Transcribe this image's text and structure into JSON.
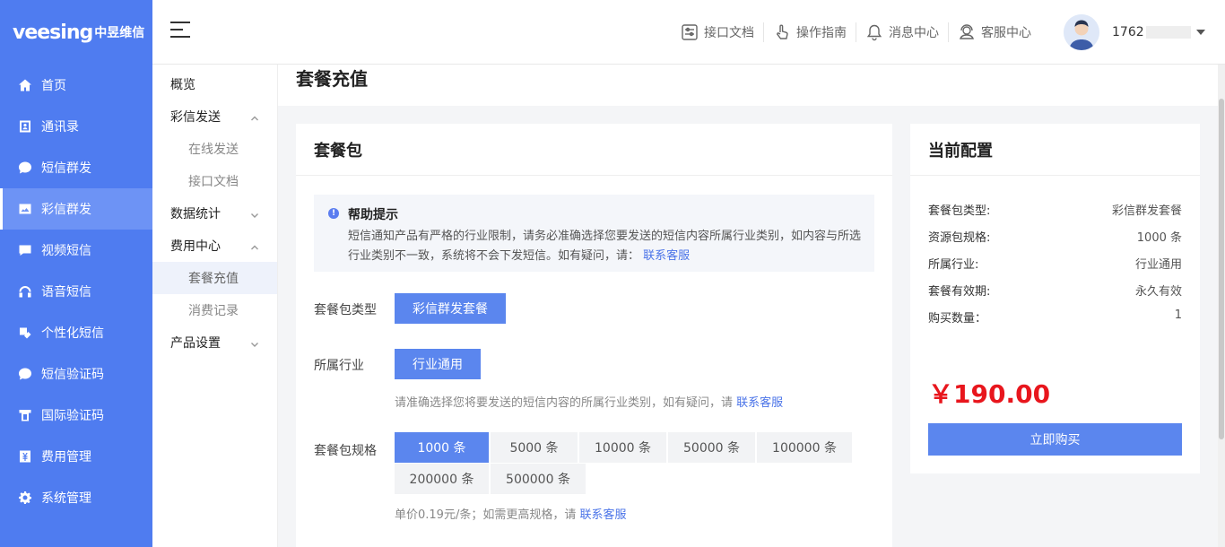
{
  "logo": {
    "brand": "veesing",
    "brand_cn": "中昱维信"
  },
  "sidebar": {
    "items": [
      {
        "label": "首页",
        "icon": "home-icon"
      },
      {
        "label": "通讯录",
        "icon": "contacts-icon"
      },
      {
        "label": "短信群发",
        "icon": "sms-icon"
      },
      {
        "label": "彩信群发",
        "icon": "mms-icon",
        "active": true
      },
      {
        "label": "视频短信",
        "icon": "video-message-icon"
      },
      {
        "label": "语音短信",
        "icon": "voice-icon"
      },
      {
        "label": "个性化短信",
        "icon": "personalized-icon"
      },
      {
        "label": "短信验证码",
        "icon": "verify-code-icon"
      },
      {
        "label": "国际验证码",
        "icon": "international-icon"
      },
      {
        "label": "费用管理",
        "icon": "yen-icon"
      },
      {
        "label": "系统管理",
        "icon": "gear-icon"
      }
    ]
  },
  "submenu": {
    "overview": "概览",
    "mms_send": "彩信发送",
    "online_send": "在线发送",
    "api_doc": "接口文档",
    "stats": "数据统计",
    "billing": "费用中心",
    "package_recharge": "套餐充值",
    "consumption": "消费记录",
    "product_settings": "产品设置"
  },
  "header": {
    "links": [
      {
        "label": "接口文档",
        "icon": "api-doc-icon"
      },
      {
        "label": "操作指南",
        "icon": "hand-pointer-icon"
      },
      {
        "label": "消息中心",
        "icon": "bell-icon"
      },
      {
        "label": "客服中心",
        "icon": "customer-service-icon"
      }
    ],
    "user_prefix": "1762"
  },
  "page": {
    "title": "套餐充值"
  },
  "package": {
    "title": "套餐包",
    "tip_title": "帮助提示",
    "tip_body": "短信通知产品有严格的行业限制，请务必准确选择您要发送的短信内容所属行业类别，如内容与所选行业类别不一致，系统将不会下发短信。如有疑问，请：",
    "contact_link": "联系客服",
    "type_label": "套餐包类型",
    "type_value": "彩信群发套餐",
    "industry_label": "所属行业",
    "industry_value": "行业通用",
    "industry_hint": "请准确选择您将要发送的短信内容的所属行业类别，如有疑问，请",
    "spec_label": "套餐包规格",
    "specs": [
      "1000 条",
      "5000 条",
      "10000 条",
      "50000 条",
      "100000 条",
      "200000 条",
      "500000 条"
    ],
    "unit_price_hint": "单价0.19元/条；如需更高规格，请"
  },
  "config": {
    "title": "当前配置",
    "rows": [
      {
        "k": "套餐包类型:",
        "v": "彩信群发套餐"
      },
      {
        "k": "资源包规格:",
        "v": "1000 条"
      },
      {
        "k": "所属行业:",
        "v": "行业通用"
      },
      {
        "k": "套餐有效期:",
        "v": "永久有效"
      },
      {
        "k": "购买数量：",
        "v": "1"
      }
    ],
    "price": "￥190.00",
    "buy_label": "立即购买"
  },
  "colors": {
    "sidebar": "#4f7cf0",
    "accent": "#5b86ee",
    "price": "#e8161d",
    "link": "#4a73e8"
  }
}
